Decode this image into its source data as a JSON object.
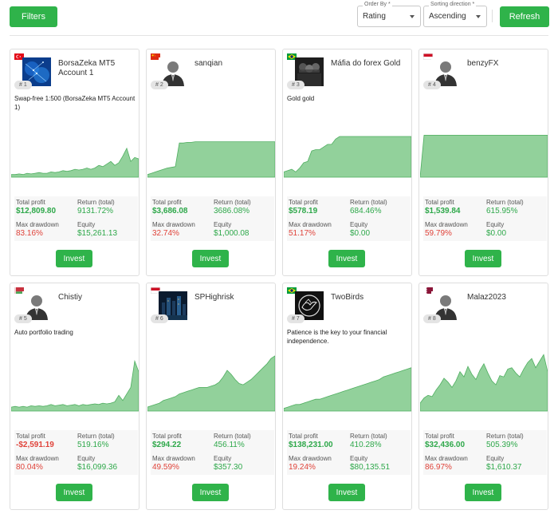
{
  "toolbar": {
    "filters_label": "Filters",
    "order_by_label": "Order By *",
    "order_by_value": "Rating",
    "sort_dir_label": "Sorting direction *",
    "sort_dir_value": "Ascending",
    "refresh_label": "Refresh"
  },
  "colors": {
    "accent": "#2fb34a",
    "positive": "#2ea84a",
    "negative": "#e0433a",
    "chart_fill": "#7fc98a"
  },
  "cards": [
    {
      "rank": "# 1",
      "name": "BorsaZeka MT5 Account 1",
      "description": "Swap-free 1:500 (BorsaZeka MT5 Account 1)",
      "flag": "turkey",
      "avatar": "network-image",
      "total_profit": "$12,809.80",
      "return_total": "9131.72%",
      "max_drawdown": "83.16%",
      "equity": "$15,261.13",
      "profit_positive": true,
      "equity_curve": [
        2,
        2,
        2.5,
        2,
        3,
        2.5,
        3,
        3.5,
        3,
        3,
        4,
        3.5,
        4,
        5,
        4.5,
        5,
        6,
        5.5,
        6,
        7,
        6,
        7,
        9,
        8,
        10,
        12,
        9,
        11,
        16,
        22,
        12,
        15,
        14
      ]
    },
    {
      "rank": "# 2",
      "name": "sanqian",
      "description": "",
      "flag": "china",
      "avatar": "person-icon",
      "total_profit": "$3,686.08",
      "return_total": "3686.08%",
      "max_drawdown": "32.74%",
      "equity": "$1,000.08",
      "profit_positive": true,
      "equity_curve": [
        2,
        3,
        4,
        5,
        6,
        7,
        7.5,
        8,
        26,
        26,
        26.5,
        26.5,
        27,
        27,
        27,
        27,
        27,
        27,
        27,
        27,
        27,
        27,
        27,
        27,
        27,
        27,
        27,
        27,
        27,
        27,
        27,
        27,
        27
      ]
    },
    {
      "rank": "# 3",
      "name": "Máfia do forex Gold",
      "description": "Gold gold",
      "flag": "brazil",
      "avatar": "mafia-image",
      "total_profit": "$578.19",
      "return_total": "684.46%",
      "max_drawdown": "51.17%",
      "equity": "$0.00",
      "profit_positive": true,
      "equity_curve": [
        4,
        5,
        6,
        4,
        7,
        11,
        12,
        20,
        21,
        21,
        23,
        25,
        25,
        29,
        31,
        31,
        31,
        31,
        31,
        31,
        31,
        31,
        31,
        31,
        31,
        31,
        31,
        31,
        31,
        31,
        31,
        31,
        31
      ]
    },
    {
      "rank": "# 4",
      "name": "benzyFX",
      "description": "",
      "flag": "indonesia",
      "avatar": "person-icon",
      "total_profit": "$1,539.84",
      "return_total": "615.95%",
      "max_drawdown": "59.79%",
      "equity": "$0.00",
      "profit_positive": true,
      "equity_curve": [
        0,
        32,
        32,
        32,
        32,
        32,
        32,
        32,
        32,
        32,
        32,
        32,
        32,
        32,
        32,
        32,
        32,
        32,
        32,
        32,
        32,
        32,
        32,
        32,
        32,
        32,
        32,
        32,
        32,
        32,
        32,
        32,
        32
      ]
    },
    {
      "rank": "# 5",
      "name": "Chistiy",
      "description": "Auto portfolio trading",
      "flag": "belarus",
      "avatar": "person-icon",
      "total_profit": "-$2,591.19",
      "return_total": "519.16%",
      "max_drawdown": "80.04%",
      "equity": "$16,099.36",
      "profit_positive": false,
      "equity_curve": [
        3,
        3.5,
        3,
        3.5,
        3,
        4,
        3.5,
        4,
        3.5,
        4,
        5,
        4,
        4.5,
        5,
        4,
        4.5,
        5,
        4,
        5,
        4.5,
        5,
        5.5,
        5,
        6,
        5.5,
        6,
        7,
        12,
        8,
        13,
        18,
        38,
        30
      ]
    },
    {
      "rank": "# 6",
      "name": "SPHighrisk",
      "description": "",
      "flag": "indonesia",
      "avatar": "city-image",
      "total_profit": "$294.22",
      "return_total": "456.11%",
      "max_drawdown": "49.59%",
      "equity": "$357.30",
      "profit_positive": true,
      "equity_curve": [
        3,
        4,
        5,
        6,
        8,
        9,
        10,
        11,
        13,
        14,
        15,
        16,
        17,
        18,
        18,
        18,
        19,
        20,
        22,
        26,
        31,
        28,
        24,
        21,
        20,
        22,
        24,
        27,
        30,
        33,
        36,
        40,
        42
      ]
    },
    {
      "rank": "# 7",
      "name": "TwoBirds",
      "description": "Patience is the key to your financial independence.",
      "flag": "brazil",
      "avatar": "birds-image",
      "total_profit": "$138,231.00",
      "return_total": "410.28%",
      "max_drawdown": "19.24%",
      "equity": "$80,135.51",
      "profit_positive": true,
      "equity_curve": [
        2,
        3,
        4,
        5,
        5,
        6,
        7,
        8,
        9,
        9,
        10,
        11,
        12,
        13,
        14,
        15,
        16,
        17,
        18,
        19,
        20,
        21,
        22,
        23,
        24,
        26,
        27,
        28,
        29,
        30,
        31,
        32,
        33
      ]
    },
    {
      "rank": "# 8",
      "name": "Malaz2023",
      "description": "",
      "flag": "qatar",
      "avatar": "person-icon",
      "total_profit": "$32,436.00",
      "return_total": "505.39%",
      "max_drawdown": "86.97%",
      "equity": "$1,610.37",
      "profit_positive": true,
      "equity_curve": [
        6,
        10,
        12,
        11,
        16,
        20,
        25,
        22,
        18,
        23,
        30,
        26,
        34,
        28,
        24,
        31,
        36,
        29,
        23,
        20,
        27,
        26,
        32,
        33,
        29,
        26,
        32,
        37,
        40,
        33,
        38,
        43,
        30
      ]
    }
  ],
  "labels": {
    "total_profit": "Total profit",
    "return_total": "Return (total)",
    "max_drawdown": "Max drawdown",
    "equity": "Equity",
    "invest": "Invest"
  }
}
